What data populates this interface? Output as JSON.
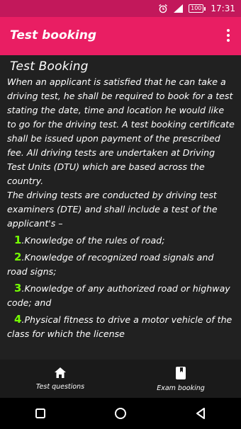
{
  "status_bar": {
    "time": "17:31",
    "battery_label": "100",
    "icons": [
      "alarm-icon",
      "signal-icon",
      "battery-icon"
    ]
  },
  "app_bar": {
    "title": "Test booking",
    "menu_icon": "overflow-menu-icon"
  },
  "content": {
    "heading": "Test Booking",
    "paragraph1": " When an applicant is satisfied that he can take a driving test, he shall be required to book for a test stating the date, time and location he would like to go for the driving test. A test booking certificate shall be issued upon payment of the prescribed fee. All driving tests are undertaken at Driving Test Units (DTU) which are based across the country.",
    "paragraph2": " The driving tests are conducted by driving test examiners (DTE) and shall include a test of the applicant's –",
    "items": [
      {
        "num": "1",
        "text": ".Knowledge of the rules of road;"
      },
      {
        "num": "2",
        "text": ".Knowledge of recognized road signals and road signs;"
      },
      {
        "num": "3",
        "text": ".Knowledge of any authorized road or highway code; and"
      },
      {
        "num": "4",
        "text": ".Physical fitness to drive a motor vehicle of the class for which the license"
      }
    ]
  },
  "bottom_nav": {
    "items": [
      {
        "label": "Test questions",
        "icon": "home-icon"
      },
      {
        "label": "Exam booking",
        "icon": "book-icon"
      }
    ]
  },
  "system_nav": {
    "icons": [
      "recents-icon",
      "home-circle-icon",
      "back-icon"
    ]
  },
  "colors": {
    "status_bar": "#c2185b",
    "app_bar": "#e91e63",
    "content_bg": "#212121",
    "list_number": "#76ff03"
  }
}
